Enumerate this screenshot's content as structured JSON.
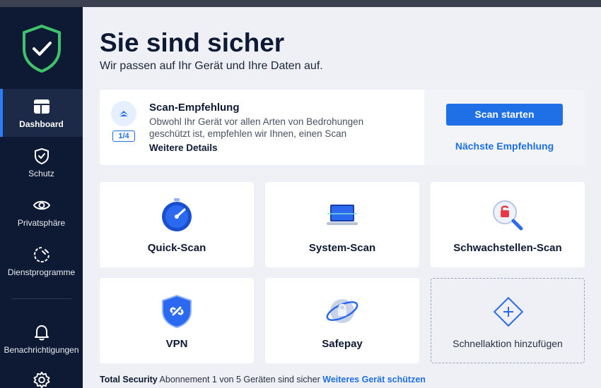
{
  "colors": {
    "sidebar": "#0e1a33",
    "accent": "#1f6fe6",
    "shield": "#3fc46b",
    "background": "#eef0f6"
  },
  "sidebar": {
    "logo_icon": "shield-check-icon",
    "items": [
      {
        "label": "Dashboard",
        "icon": "dashboard-icon",
        "active": true
      },
      {
        "label": "Schutz",
        "icon": "shield-icon"
      },
      {
        "label": "Privatsphäre",
        "icon": "eye-icon"
      },
      {
        "label": "Dienstprogramme",
        "icon": "tools-icon"
      },
      {
        "label": "Benachrichtigungen",
        "icon": "bell-icon"
      },
      {
        "label": "",
        "icon": "gear-icon"
      }
    ]
  },
  "header": {
    "title": "Sie sind sicher",
    "subtitle": "Wir passen auf Ihr Gerät und Ihre Daten auf."
  },
  "recommendation": {
    "counter": "1/4",
    "title": "Scan-Empfehlung",
    "text": "Obwohl Ihr Gerät vor allen Arten von Bedrohungen geschützt ist, empfehlen wir Ihnen, einen Scan",
    "details_link": "Weitere Details",
    "primary_button": "Scan starten",
    "next_link": "Nächste Empfehlung"
  },
  "quick_actions": [
    {
      "label": "Quick-Scan",
      "icon": "stopwatch-icon"
    },
    {
      "label": "System-Scan",
      "icon": "laptop-icon"
    },
    {
      "label": "Schwachstellen-Scan",
      "icon": "magnifier-lock-icon"
    },
    {
      "label": "VPN",
      "icon": "vpn-shield-icon"
    },
    {
      "label": "Safepay",
      "icon": "safepay-icon"
    },
    {
      "label": "Schnellaktion hinzufügen",
      "icon": "add-icon"
    }
  ],
  "footer": {
    "product": "Total Security",
    "status": "Abonnement 1 von 5 Geräten sind sicher",
    "link": "Weiteres Gerät schützen"
  }
}
